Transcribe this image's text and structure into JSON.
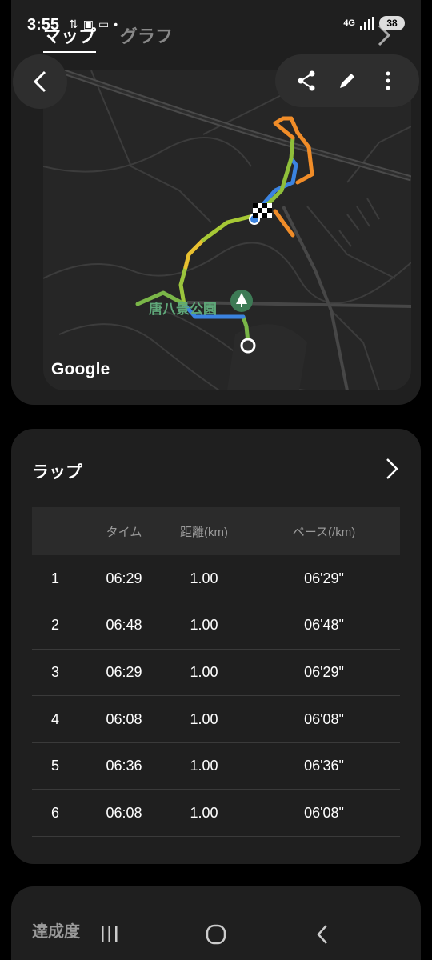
{
  "status": {
    "time": "3:55",
    "network": "4G",
    "battery": "38"
  },
  "tabs": [
    {
      "label": "マップ",
      "active": true
    },
    {
      "label": "グラフ",
      "active": false
    }
  ],
  "map": {
    "park_label": "唐八景公園",
    "attribution": "Google"
  },
  "laps": {
    "title": "ラップ",
    "headers": [
      "",
      "タイム",
      "距離(km)",
      "ペース(/km)"
    ],
    "rows": [
      [
        "1",
        "06:29",
        "1.00",
        "06'29\""
      ],
      [
        "2",
        "06:48",
        "1.00",
        "06'48\""
      ],
      [
        "3",
        "06:29",
        "1.00",
        "06'29\""
      ],
      [
        "4",
        "06:08",
        "1.00",
        "06'08\""
      ],
      [
        "5",
        "06:36",
        "1.00",
        "06'36\""
      ],
      [
        "6",
        "06:08",
        "1.00",
        "06'08\""
      ]
    ]
  },
  "achievement": {
    "title": "達成度"
  },
  "icons": {
    "back": "back-arrow-icon",
    "share": "share-icon",
    "edit": "pencil-icon",
    "more": "more-vertical-icon",
    "recents": "recents-icon",
    "home": "home-icon",
    "nav_back": "nav-back-icon"
  }
}
